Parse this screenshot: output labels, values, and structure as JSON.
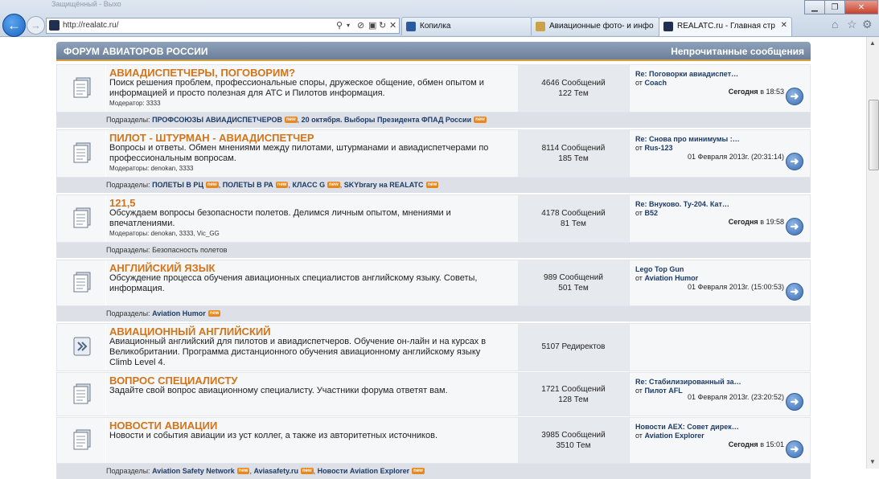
{
  "window": {
    "title": "Защищённый - Выхо"
  },
  "address_bar": {
    "url": "http://realatc.ru/"
  },
  "tabs": [
    {
      "label": "Копилка",
      "favicon_color": "#2b5aa0"
    },
    {
      "label": "Авиационные фото- и инфо-…",
      "favicon_color": "#c9a24a"
    },
    {
      "label": "REALATC.ru - Главная стра…",
      "favicon_color": "#1f2f52",
      "active": true
    }
  ],
  "icons": {
    "back": "back-arrow-icon",
    "forward": "forward-arrow-icon",
    "home": "home-icon",
    "favorites": "star-icon",
    "tools": "gear-icon",
    "search": "search-icon",
    "refresh": "refresh-icon",
    "stop": "stop-icon",
    "compat": "compat-view-icon"
  },
  "forum": {
    "header_title": "ФОРУМ АВИАТОРОВ РОССИИ",
    "header_unread": "Непрочитанные сообщения",
    "nodes": [
      {
        "title": "АВИАДИСПЕТЧЕРЫ, ПОГОВОРИМ?",
        "description": "Поиск решения проблем, профессиональные споры, дружеское общение, обмен опытом и информацией и просто полезная для АТС и Пилотов информация.",
        "moderators": "Модератор: 3333",
        "messages": "4646 Сообщений",
        "topics": "122 Тем",
        "last_title": "Re: Поговорки авиадиспет…",
        "last_by_prefix": "от",
        "last_by": "Coach",
        "last_date_bold": "Сегодня",
        "last_date_rest": "в 18:53",
        "subforums_label": "Подразделы:",
        "subforums": [
          {
            "name": "ПРОФСОЮЗЫ АВИАДИСПЕТЧЕРОВ",
            "new": true
          },
          {
            "name": "20 октября. Выборы Президента ФПАД России",
            "new": true
          }
        ]
      },
      {
        "title": "ПИЛОТ - ШТУРМАН - АВИАДИСПЕТЧЕР",
        "description": "Вопросы и ответы. Обмен мнениями между пилотами, штурманами и авиадиспетчерами по профессиональным вопросам.",
        "moderators": "Модераторы: denokan, 3333",
        "messages": "8114 Сообщений",
        "topics": "185 Тем",
        "last_title": "Re: Снова про минимумы :…",
        "last_by_prefix": "от",
        "last_by": "Rus-123",
        "last_date_bold": "",
        "last_date_rest": "01 Февраля 2013г. (20:31:14)",
        "subforums_label": "Подразделы:",
        "subforums": [
          {
            "name": "ПОЛЕТЫ В РЦ",
            "new": true
          },
          {
            "name": "ПОЛЕТЫ В РА",
            "new": true
          },
          {
            "name": "КЛАСС G",
            "new": true
          },
          {
            "name": "SKYbrary на REALATC",
            "new": true
          }
        ]
      },
      {
        "title": "121,5",
        "description": "Обсуждаем вопросы безопасности полетов. Делимся личным опытом, мнениями и впечатлениями.",
        "moderators": "Модераторы: denokan, 3333, Vic_GG",
        "messages": "4178 Сообщений",
        "topics": "81 Тем",
        "last_title": "Re: Внуково. Ту-204. Кат…",
        "last_by_prefix": "от",
        "last_by": "B52",
        "last_date_bold": "Сегодня",
        "last_date_rest": "в 19:58",
        "subforums_label": "Подразделы:",
        "subforums_plain": "Безопасность полетов"
      },
      {
        "title": "АНГЛИЙСКИЙ ЯЗЫК",
        "description": "Обсуждение процесса обучения авиационных специалистов английскому языку. Советы, информация.",
        "moderators": "",
        "messages": "989 Сообщений",
        "topics": "501 Тем",
        "last_title": "Lego Top Gun",
        "last_by_prefix": "от",
        "last_by": "Aviation Humor",
        "last_date_bold": "",
        "last_date_rest": "01 Февраля 2013г. (15:00:53)",
        "subforums_label": "Подразделы:",
        "subforums": [
          {
            "name": "Aviation Humor",
            "new": true
          }
        ]
      },
      {
        "title": "АВИАЦИОННЫЙ АНГЛИЙСКИЙ",
        "description": "Авиационный английский для пилотов и авиадиспетчеров. Обучение он-лайн и на курсах в Великобритании. Программа дистанционного обучения авиационному английскому языку Climb Level 4.",
        "moderators": "",
        "messages": "5107 Редиректов",
        "topics": "",
        "redirect": true
      },
      {
        "title": "ВОПРОС СПЕЦИАЛИСТУ",
        "description": "Задайте свой вопрос авиационному специалисту. Участники форума ответят вам.",
        "moderators": "",
        "messages": "1721 Сообщений",
        "topics": "128 Тем",
        "last_title": "Re: Стабилизированный за…",
        "last_by_prefix": "от",
        "last_by": "Пилот AFL",
        "last_date_bold": "",
        "last_date_rest": "01 Февраля 2013г. (23:20:52)"
      },
      {
        "title": "НОВОСТИ АВИАЦИИ",
        "description": "Новости и события авиации из уст коллег, а также из авторитетных источников.",
        "moderators": "",
        "messages": "3985 Сообщений",
        "topics": "3510 Тем",
        "last_title": "Новости AEX: Совет дирек…",
        "last_by_prefix": "от",
        "last_by": "Aviation Explorer",
        "last_date_bold": "Сегодня",
        "last_date_rest": "в 15:01",
        "subforums_label": "Подразделы:",
        "subforums": [
          {
            "name": "Aviation Safety Network",
            "new": true
          },
          {
            "name": "Aviasafety.ru",
            "new": true
          },
          {
            "name": "Новости Aviation Explorer",
            "new": true
          }
        ]
      }
    ]
  }
}
